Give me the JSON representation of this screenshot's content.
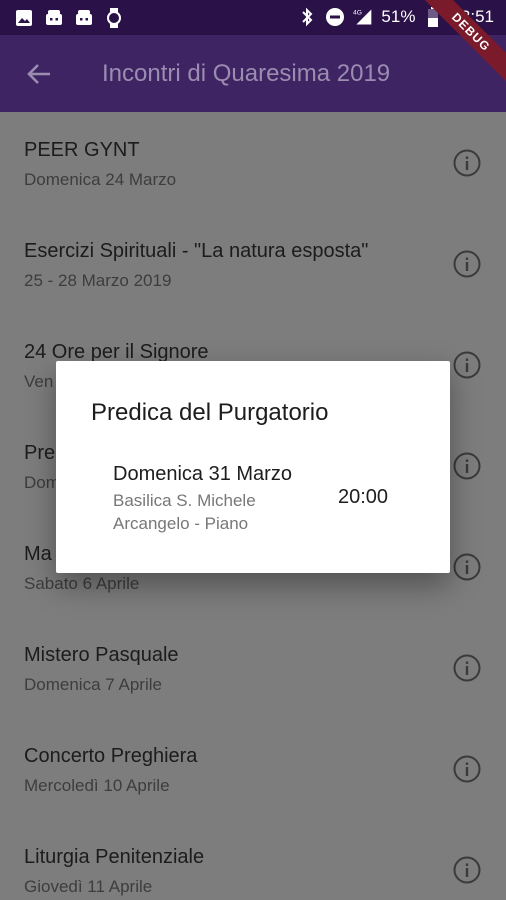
{
  "status_bar": {
    "left_icons": [
      "image-icon",
      "android-icon",
      "android-icon",
      "watch-icon"
    ],
    "right_icons": [
      "bluetooth-icon",
      "do-not-disturb-icon",
      "signal-4g-icon"
    ],
    "network": "4G",
    "battery": "51%",
    "time": "13:51"
  },
  "debug_banner": "DEBUG",
  "app_bar": {
    "back_icon": "arrow-back-icon",
    "title": "Incontri di Quaresima 2019"
  },
  "events": [
    {
      "title": "PEER GYNT",
      "subtitle": "Domenica 24 Marzo"
    },
    {
      "title": "Esercizi Spirituali - \"La natura esposta\"",
      "subtitle": "25 - 28 Marzo 2019"
    },
    {
      "title": "24 Ore per il Signore",
      "subtitle": "Ven"
    },
    {
      "title": "Pre",
      "subtitle": "Dom"
    },
    {
      "title": "Ma",
      "subtitle": "Sabato 6 Aprile"
    },
    {
      "title": "Mistero Pasquale",
      "subtitle": "Domenica 7 Aprile"
    },
    {
      "title": "Concerto Preghiera",
      "subtitle": "Mercoledì 10 Aprile"
    },
    {
      "title": "Liturgia Penitenziale",
      "subtitle": "Giovedì 11 Aprile"
    }
  ],
  "dialog": {
    "title": "Predica del Purgatorio",
    "date": "Domenica 31 Marzo",
    "place": "Basilica S. Michele Arcangelo - Piano",
    "time": "20:00"
  },
  "colors": {
    "status_bar": "#2a1148",
    "app_bar": "#3f2464",
    "app_bar_title": "#9a8db0",
    "background_dimmed": "#7d7d7d",
    "debug_ribbon": "#7a1a2a"
  }
}
